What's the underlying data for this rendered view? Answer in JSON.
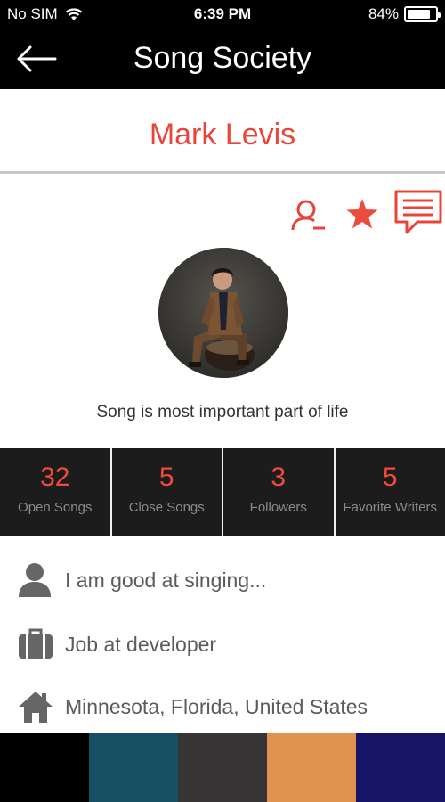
{
  "status": {
    "carrier": "No SIM",
    "time": "6:39 PM",
    "battery": "84%",
    "battery_level": 0.84
  },
  "nav": {
    "title": "Song Society"
  },
  "profile": {
    "name": "Mark Levis",
    "tagline": "Song is most important part of life"
  },
  "stats": [
    {
      "value": "32",
      "label": "Open Songs"
    },
    {
      "value": "5",
      "label": "Close Songs"
    },
    {
      "value": "3",
      "label": "Followers"
    },
    {
      "value": "5",
      "label": "Favorite Writers"
    }
  ],
  "info": [
    {
      "icon": "person-icon",
      "text": "I am good at singing..."
    },
    {
      "icon": "briefcase-icon",
      "text": "Job at developer"
    },
    {
      "icon": "home-icon",
      "text": "Minnesota, Florida, United States"
    }
  ],
  "colors": {
    "accent": "#e8443a",
    "palette": [
      "#000000",
      "#164e63",
      "#363435",
      "#e0934e",
      "#151466"
    ]
  }
}
